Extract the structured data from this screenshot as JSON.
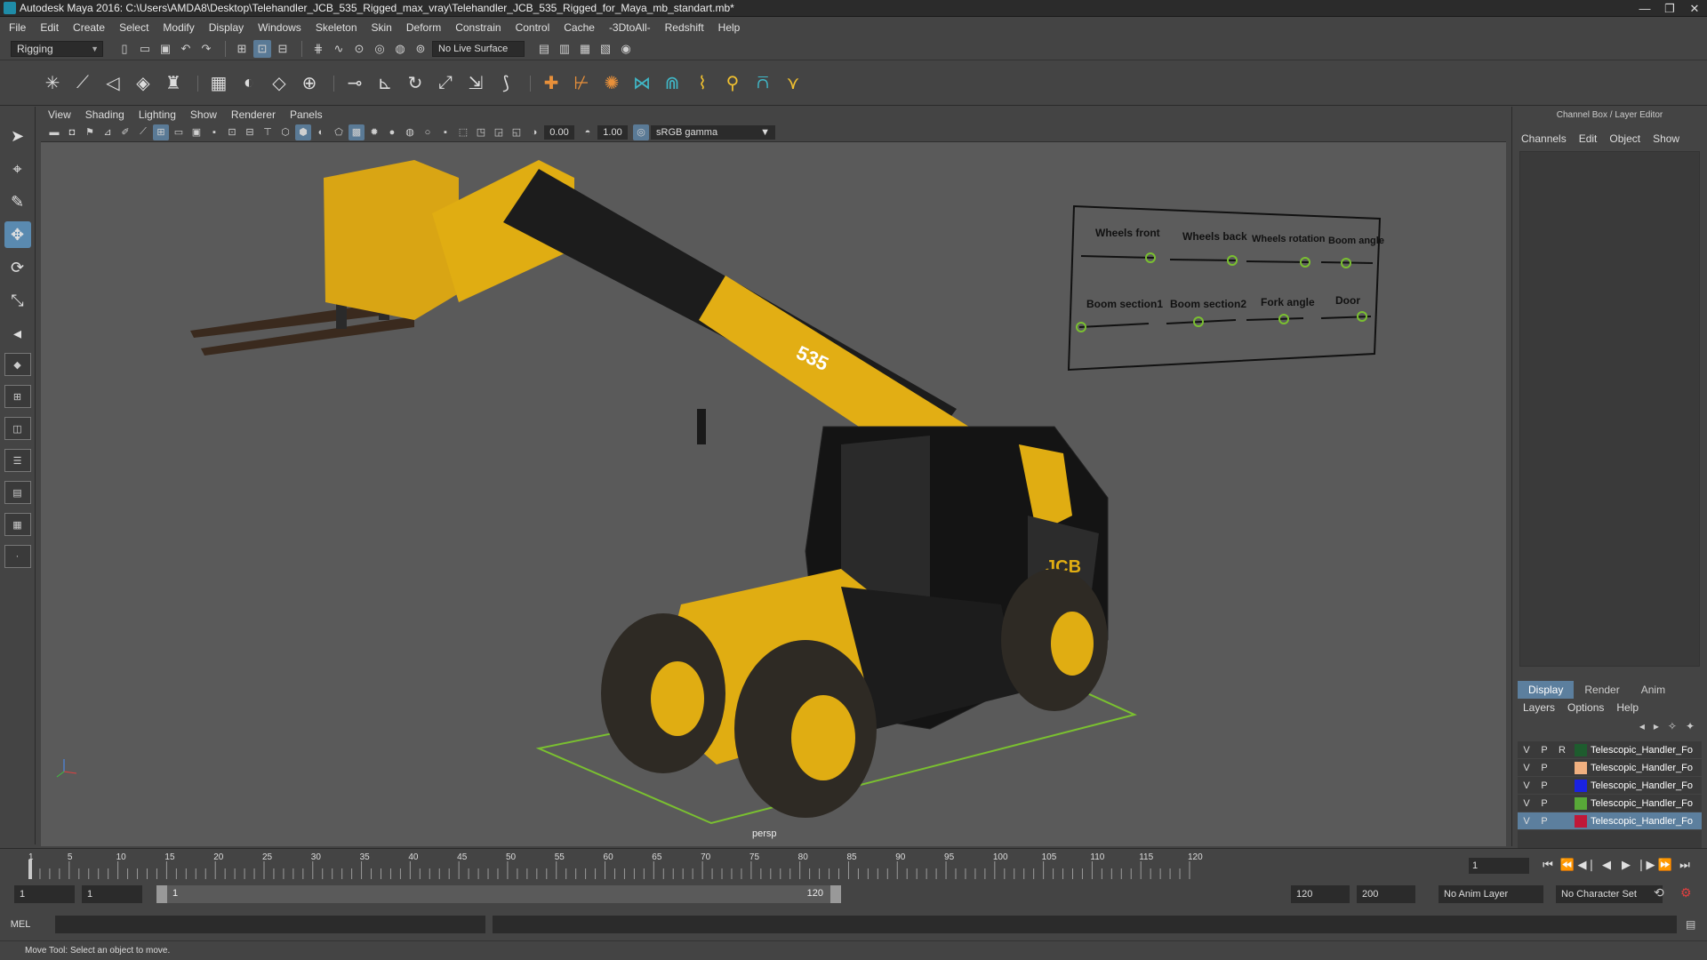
{
  "window": {
    "title": "Autodesk Maya 2016: C:\\Users\\AMDA8\\Desktop\\Telehandler_JCB_535_Rigged_max_vray\\Telehandler_JCB_535_Rigged_for_Maya_mb_standart.mb*",
    "minimize": "—",
    "maximize": "❐",
    "close": "✕"
  },
  "menu": [
    "File",
    "Edit",
    "Create",
    "Select",
    "Modify",
    "Display",
    "Windows",
    "Skeleton",
    "Skin",
    "Deform",
    "Constrain",
    "Control",
    "Cache",
    "-3DtoAll-",
    "Redshift",
    "Help"
  ],
  "status": {
    "mode": "Rigging",
    "live_surface": "No Live Surface"
  },
  "viewport": {
    "menu": [
      "View",
      "Shading",
      "Lighting",
      "Show",
      "Renderer",
      "Panels"
    ],
    "exposure": "0.00",
    "gamma": "1.00",
    "color_space": "sRGB gamma",
    "camera": "persp"
  },
  "controls_board": {
    "row1": [
      "Wheels front",
      "Wheels back",
      "Wheels rotation",
      "Boom angle"
    ],
    "row2": [
      "Boom section1",
      "Boom section2",
      "Fork angle",
      "Door"
    ]
  },
  "vehicle": {
    "model_badge": "535",
    "brand": "JCB"
  },
  "channel_box": {
    "header": "Channel Box / Layer Editor",
    "menu": [
      "Channels",
      "Edit",
      "Object",
      "Show"
    ]
  },
  "layer_editor": {
    "tabs": [
      "Display",
      "Render",
      "Anim"
    ],
    "menu": [
      "Layers",
      "Options",
      "Help"
    ],
    "layers": [
      {
        "v": "V",
        "p": "P",
        "r": "R",
        "color": "#1e5c2e",
        "name": "Telescopic_Handler_Fo"
      },
      {
        "v": "V",
        "p": "P",
        "r": "",
        "color": "#f0b080",
        "name": "Telescopic_Handler_Fo"
      },
      {
        "v": "V",
        "p": "P",
        "r": "",
        "color": "#1a22e0",
        "name": "Telescopic_Handler_Fo"
      },
      {
        "v": "V",
        "p": "P",
        "r": "",
        "color": "#58a838",
        "name": "Telescopic_Handler_Fo"
      },
      {
        "v": "V",
        "p": "P",
        "r": "",
        "color": "#c01838",
        "name": "Telescopic_Handler_Fo"
      }
    ]
  },
  "timeline": {
    "ticks": [
      "5",
      "10",
      "15",
      "20",
      "25",
      "30",
      "35",
      "40",
      "45",
      "50",
      "55",
      "60",
      "65",
      "70",
      "75",
      "80",
      "85",
      "90",
      "95",
      "100",
      "105",
      "110",
      "115",
      "120"
    ],
    "first_tick": "1",
    "current_frame": "1",
    "playhead_frame": 1,
    "range_start": 1,
    "range_end": 120
  },
  "range": {
    "start": "1",
    "playback_start": "1",
    "slider_start": "1",
    "slider_end": "120",
    "playback_end": "120",
    "end": "200",
    "anim_layer": "No Anim Layer",
    "character_set": "No Character Set"
  },
  "command": {
    "label": "MEL"
  },
  "help": {
    "text": "Move Tool: Select an object to move."
  },
  "colors": {
    "accent": "#5c7f9e",
    "jcb_yellow": "#e8b010",
    "grid_green": "#7ac030"
  }
}
